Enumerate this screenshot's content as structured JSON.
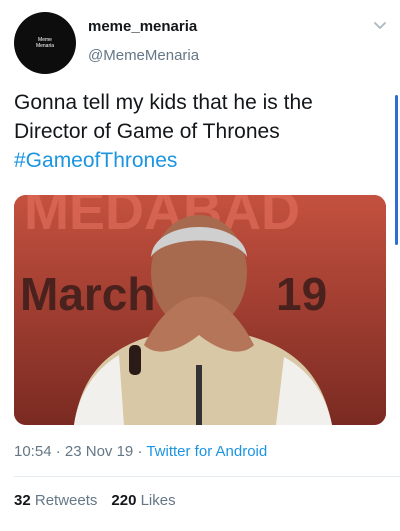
{
  "user": {
    "display_name": "meme_menaria",
    "handle": "@MemeMenaria",
    "avatar_text": "Meme Menaria"
  },
  "tweet": {
    "line1": "Gonna tell my kids that he is the",
    "line2": "Director of Game of Thrones",
    "hashtag": "#GameofThrones"
  },
  "photo": {
    "banner_top": "MEDABAD",
    "banner_month": "March",
    "banner_year": "19"
  },
  "meta": {
    "time": "10:54",
    "sep1": " · ",
    "date": "23 Nov 19",
    "sep2": " · ",
    "source": "Twitter for Android"
  },
  "stats": {
    "retweets_count": "32",
    "retweets_label": "Retweets",
    "likes_count": "220",
    "likes_label": "Likes"
  },
  "icons": {
    "caret": "chevron-down-icon"
  },
  "colors": {
    "link": "#1b95e0",
    "secondary": "#657786",
    "text": "#14171a"
  }
}
